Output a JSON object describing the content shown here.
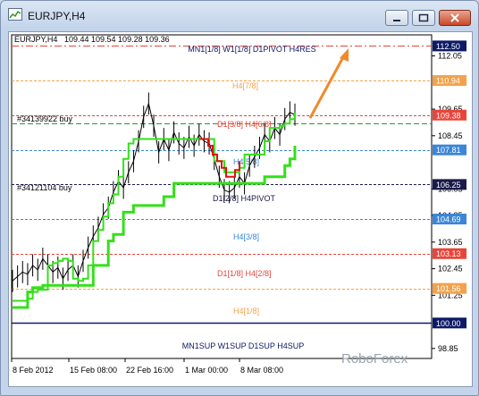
{
  "window": {
    "title": "EURJPY,H4",
    "buttons": [
      "minimize",
      "maximize",
      "close"
    ],
    "icon": "chart-window-icon"
  },
  "header": {
    "symbol": "EURJPY,H4",
    "ohlc": "109.44 109.54 109.28 109.36"
  },
  "order_labels": [
    "#34139922 buy",
    "#34121104 buy"
  ],
  "level_labels": {
    "res": "MN1[1/8] W1[1/8] D1PIVOT H4RES",
    "h4_78": "H4[7/8]",
    "d1_h4": "D1[3/8] H4[6/8]",
    "h4_58": "H4[5/8]",
    "pivot": "D1[2/8] H4PIVOT",
    "h4_38": "H4[3/8]",
    "d1_h4_28": "D1[1/8] H4[2/8]",
    "h4_18": "H4[1/8]",
    "sup": "MN1SUP W1SUP D1SUP H4SUP"
  },
  "price_axis": {
    "ticks": [
      "112.05",
      "109.65",
      "108.45",
      "106.05",
      "104.85",
      "103.65",
      "102.45",
      "101.25",
      "98.85"
    ],
    "badges": [
      {
        "label": "112.50",
        "color": "#0d1a66"
      },
      {
        "label": "110.94",
        "color": "#f4a24a"
      },
      {
        "label": "109.38",
        "color": "#e8453a"
      },
      {
        "label": "107.81",
        "color": "#3b86d8"
      },
      {
        "label": "106.25",
        "color": "#1a1a4a"
      },
      {
        "label": "104.69",
        "color": "#3b86d8"
      },
      {
        "label": "103.13",
        "color": "#e8453a"
      },
      {
        "label": "101.56",
        "color": "#f4a24a"
      },
      {
        "label": "100.00",
        "color": "#0d1a66"
      }
    ]
  },
  "time_axis": [
    "8 Feb 2012",
    "15 Feb 08:00",
    "22 Feb 16:00",
    "1 Mar 00:00",
    "8 Mar 08:00"
  ],
  "watermark": "RoboForex",
  "chart_data": {
    "type": "line",
    "title": "EURJPY,H4",
    "xlabel": "",
    "ylabel": "",
    "ylim": [
      98.4,
      113.0
    ],
    "x": [
      "8 Feb 2012",
      "15 Feb 08:00",
      "22 Feb 16:00",
      "1 Mar 00:00",
      "8 Mar 08:00"
    ],
    "levels": [
      {
        "name": "MN1[1/8] W1[1/8] D1PIVOT H4RES",
        "value": 112.5
      },
      {
        "name": "H4[7/8]",
        "value": 110.94
      },
      {
        "name": "D1[3/8] H4[6/8]",
        "value": 109.38
      },
      {
        "name": "H4[5/8]",
        "value": 107.81
      },
      {
        "name": "D1[2/8] H4PIVOT",
        "value": 106.25
      },
      {
        "name": "H4[3/8]",
        "value": 104.69
      },
      {
        "name": "D1[1/8] H4[2/8]",
        "value": 103.13
      },
      {
        "name": "H4[1/8]",
        "value": 101.56
      },
      {
        "name": "MN1SUP W1SUP D1SUP H4SUP",
        "value": 100.0
      }
    ],
    "series": [
      {
        "values": [
          101.9,
          102.1,
          102.3,
          102.2,
          102.6,
          102.4,
          102.9,
          102.6,
          102.3,
          102.5,
          102.0,
          102.4,
          102.6,
          102.1,
          102.8,
          103.4,
          103.9,
          104.3,
          104.9,
          105.2,
          105.9,
          106.4,
          106.1,
          106.8,
          107.3,
          108.2,
          109.3,
          109.9,
          108.9,
          107.7,
          108.3,
          107.8,
          108.6,
          108.1,
          107.9,
          108.4,
          108.0,
          108.5,
          108.2,
          108.1,
          107.4,
          106.6,
          106.0,
          105.9,
          106.1,
          106.6,
          106.3,
          107.1,
          107.5,
          107.9,
          108.5,
          108.2,
          108.8,
          108.5,
          109.2,
          109.5,
          109.4
        ],
        "color": "#000000"
      },
      {
        "values": [
          101.0,
          101.0,
          101.0,
          101.1,
          101.4,
          101.5,
          101.5,
          102.6,
          102.7,
          102.8,
          102.9,
          102.8,
          102.0,
          101.9,
          102.0,
          102.6,
          103.7,
          104.2,
          104.8,
          105.4,
          105.8,
          106.6,
          107.4,
          108.1,
          108.3,
          108.3,
          108.3,
          108.3,
          108.3,
          108.3,
          108.3,
          108.3,
          108.3,
          108.3,
          108.3,
          108.3,
          108.3,
          108.3,
          108.3,
          108.3,
          107.3,
          107.3,
          106.8,
          106.8,
          106.8,
          107.0,
          107.6,
          107.6,
          107.6,
          107.6,
          108.2,
          108.8,
          108.8,
          108.9,
          109.0,
          109.2,
          109.5
        ],
        "color": "#33e01a"
      },
      {
        "values": [
          108.3,
          108.3,
          108.0,
          107.6,
          107.3,
          107.0,
          106.6,
          106.6,
          106.9,
          107.3
        ],
        "color": "#e01010"
      },
      {
        "values": [
          100.7,
          100.7,
          100.7,
          101.4,
          101.6,
          101.6,
          101.7,
          101.7,
          101.7,
          101.7,
          101.7,
          101.7,
          101.7,
          101.7,
          101.7,
          101.7,
          102.6,
          102.6,
          102.6,
          103.7,
          104.0,
          104.0,
          105.0,
          105.0,
          105.3,
          105.3,
          105.3,
          105.3,
          105.3,
          105.3,
          105.7,
          105.7,
          106.3,
          106.3,
          106.3,
          106.3,
          106.3,
          106.3,
          106.3,
          106.3,
          106.3,
          106.3,
          106.3,
          106.3,
          106.3,
          106.3,
          106.3,
          106.3,
          106.3,
          106.3,
          106.6,
          106.6,
          106.6,
          106.6,
          107.1,
          107.4,
          108.0
        ],
        "color": "#33e01a"
      }
    ]
  }
}
